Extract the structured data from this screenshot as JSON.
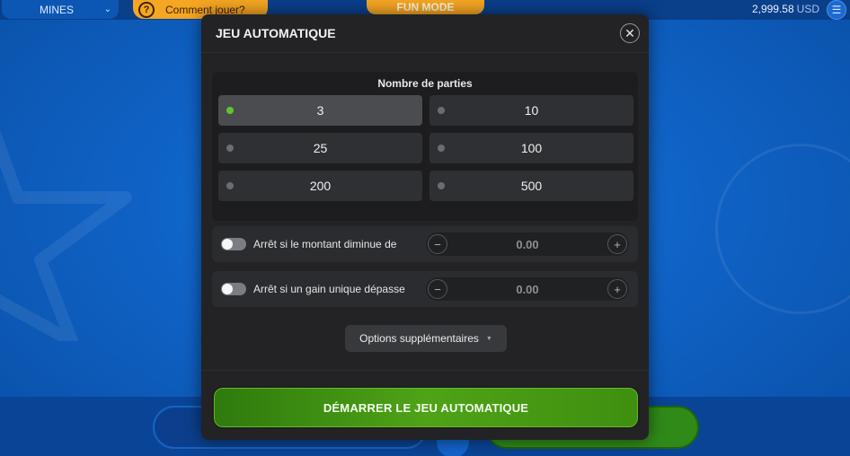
{
  "header": {
    "game_name": "MINES",
    "how_to_play": "Comment jouer?",
    "mode": "FUN MODE",
    "balance_amount": "2,999.58",
    "balance_currency": "USD"
  },
  "modal": {
    "title": "JEU AUTOMATIQUE",
    "rounds": {
      "title": "Nombre de parties",
      "options": [
        "3",
        "10",
        "25",
        "100",
        "200",
        "500"
      ],
      "selected": "3"
    },
    "stop_loss": {
      "label": "Arrêt si le montant diminue de",
      "value": "0.00",
      "enabled": false
    },
    "stop_win": {
      "label": "Arrêt si un gain unique dépasse",
      "value": "0.00",
      "enabled": false
    },
    "options_label": "Options supplémentaires",
    "start_label": "DÉMARRER LE JEU AUTOMATIQUE"
  },
  "colors": {
    "accent_green": "#4fa316",
    "selected_dot": "#5ec72a",
    "modal_bg": "#232325",
    "game_bg": "#0f63c6",
    "orange": "#f5a623"
  }
}
